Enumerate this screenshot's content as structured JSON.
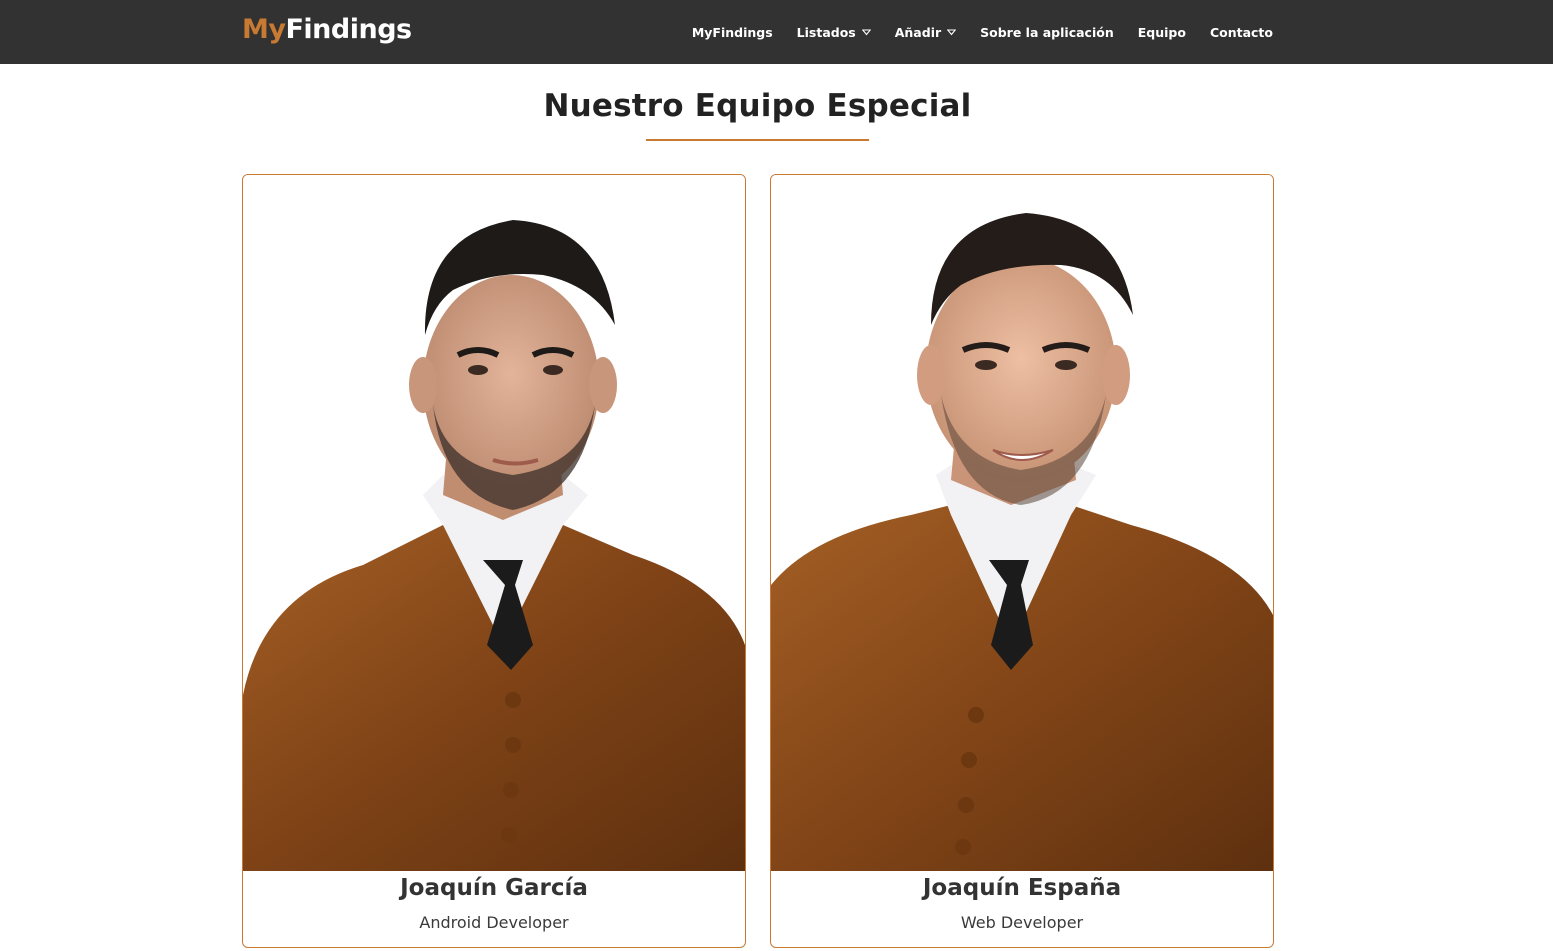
{
  "brand": {
    "part1": "My",
    "part2": "Findings"
  },
  "nav": {
    "items": [
      {
        "label": "MyFindings",
        "dropdown": false
      },
      {
        "label": "Listados",
        "dropdown": true
      },
      {
        "label": "Añadir",
        "dropdown": true
      },
      {
        "label": "Sobre la aplicación",
        "dropdown": false
      },
      {
        "label": "Equipo",
        "dropdown": false
      },
      {
        "label": "Contacto",
        "dropdown": false
      }
    ]
  },
  "page": {
    "title": "Nuestro Equipo Especial"
  },
  "team": [
    {
      "name": "Joaquín García",
      "role": "Android Developer"
    },
    {
      "name": "Joaquín España",
      "role": "Web Developer"
    }
  ],
  "colors": {
    "accent": "#c87a33",
    "navbar": "#323232",
    "gown": "#8a4a1a"
  }
}
